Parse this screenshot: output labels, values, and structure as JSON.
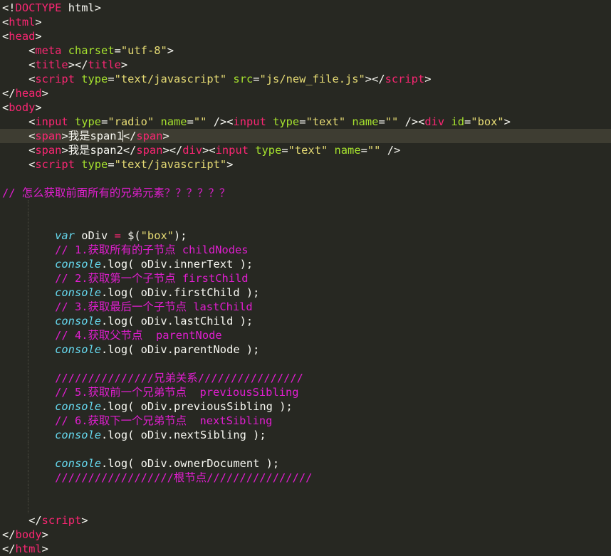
{
  "editor": {
    "theme": "monokai",
    "colors": {
      "background": "#272822",
      "current_line": "#3e3d32",
      "text": "#f8f8f2",
      "tag": "#f92672",
      "attribute": "#a6e22e",
      "string": "#e6db74",
      "keyword": "#66d9ef",
      "comment": "#e01ecf"
    },
    "current_line_index": 9,
    "lines": [
      [
        [
          "punct",
          "<!"
        ],
        [
          "tag",
          "DOCTYPE"
        ],
        [
          "plain",
          " html>"
        ]
      ],
      [
        [
          "punct",
          "<"
        ],
        [
          "tag",
          "html"
        ],
        [
          "punct",
          ">"
        ]
      ],
      [
        [
          "punct",
          "<"
        ],
        [
          "tag",
          "head"
        ],
        [
          "punct",
          ">"
        ]
      ],
      [
        [
          "plain",
          "    "
        ],
        [
          "punct",
          "<"
        ],
        [
          "tag",
          "meta"
        ],
        [
          "plain",
          " "
        ],
        [
          "attr",
          "charset"
        ],
        [
          "punct",
          "="
        ],
        [
          "str",
          "\"utf-8\""
        ],
        [
          "punct",
          ">"
        ]
      ],
      [
        [
          "plain",
          "    "
        ],
        [
          "punct",
          "<"
        ],
        [
          "tag",
          "title"
        ],
        [
          "punct",
          "></"
        ],
        [
          "tag",
          "title"
        ],
        [
          "punct",
          ">"
        ]
      ],
      [
        [
          "plain",
          "    "
        ],
        [
          "punct",
          "<"
        ],
        [
          "tag",
          "script"
        ],
        [
          "plain",
          " "
        ],
        [
          "attr",
          "type"
        ],
        [
          "punct",
          "="
        ],
        [
          "str",
          "\"text/javascript\""
        ],
        [
          "plain",
          " "
        ],
        [
          "attr",
          "src"
        ],
        [
          "punct",
          "="
        ],
        [
          "str",
          "\"js/new_file.js\""
        ],
        [
          "punct",
          "></"
        ],
        [
          "tag",
          "script"
        ],
        [
          "punct",
          ">"
        ]
      ],
      [
        [
          "punct",
          "</"
        ],
        [
          "tag",
          "head"
        ],
        [
          "punct",
          ">"
        ]
      ],
      [
        [
          "punct",
          "<"
        ],
        [
          "tag",
          "body"
        ],
        [
          "punct",
          ">"
        ]
      ],
      [
        [
          "plain",
          "    "
        ],
        [
          "punct",
          "<"
        ],
        [
          "tag",
          "input"
        ],
        [
          "plain",
          " "
        ],
        [
          "attr",
          "type"
        ],
        [
          "punct",
          "="
        ],
        [
          "str",
          "\"radio\""
        ],
        [
          "plain",
          " "
        ],
        [
          "attr",
          "name"
        ],
        [
          "punct",
          "="
        ],
        [
          "str",
          "\"\""
        ],
        [
          "plain",
          " "
        ],
        [
          "punct",
          "/><"
        ],
        [
          "tag",
          "input"
        ],
        [
          "plain",
          " "
        ],
        [
          "attr",
          "type"
        ],
        [
          "punct",
          "="
        ],
        [
          "str",
          "\"text\""
        ],
        [
          "plain",
          " "
        ],
        [
          "attr",
          "name"
        ],
        [
          "punct",
          "="
        ],
        [
          "str",
          "\"\""
        ],
        [
          "plain",
          " "
        ],
        [
          "punct",
          "/><"
        ],
        [
          "tag",
          "div"
        ],
        [
          "plain",
          " "
        ],
        [
          "attr",
          "id"
        ],
        [
          "punct",
          "="
        ],
        [
          "str",
          "\"box\""
        ],
        [
          "punct",
          ">"
        ]
      ],
      [
        [
          "plain",
          "    "
        ],
        [
          "punct",
          "<"
        ],
        [
          "tag",
          "span"
        ],
        [
          "punct",
          ">"
        ],
        [
          "plain",
          "我是span1"
        ],
        [
          "cursor",
          ""
        ],
        [
          "punct",
          "</"
        ],
        [
          "tag",
          "span"
        ],
        [
          "punct",
          ">"
        ]
      ],
      [
        [
          "plain",
          "    "
        ],
        [
          "punct",
          "<"
        ],
        [
          "tag",
          "span"
        ],
        [
          "punct",
          ">"
        ],
        [
          "plain",
          "我是span2"
        ],
        [
          "punct",
          "</"
        ],
        [
          "tag",
          "span"
        ],
        [
          "punct",
          "></"
        ],
        [
          "tag",
          "div"
        ],
        [
          "punct",
          "><"
        ],
        [
          "tag",
          "input"
        ],
        [
          "plain",
          " "
        ],
        [
          "attr",
          "type"
        ],
        [
          "punct",
          "="
        ],
        [
          "str",
          "\"text\""
        ],
        [
          "plain",
          " "
        ],
        [
          "attr",
          "name"
        ],
        [
          "punct",
          "="
        ],
        [
          "str",
          "\"\""
        ],
        [
          "plain",
          " "
        ],
        [
          "punct",
          "/>"
        ]
      ],
      [
        [
          "plain",
          "    "
        ],
        [
          "punct",
          "<"
        ],
        [
          "tag",
          "script"
        ],
        [
          "plain",
          " "
        ],
        [
          "attr",
          "type"
        ],
        [
          "punct",
          "="
        ],
        [
          "str",
          "\"text/javascript\""
        ],
        [
          "punct",
          ">"
        ]
      ],
      [],
      [
        [
          "comment",
          "// 怎么获取前面所有的兄弟元素？？？？？？"
        ]
      ],
      [],
      [],
      [
        [
          "plain",
          "        "
        ],
        [
          "kw",
          "var"
        ],
        [
          "plain",
          " oDiv "
        ],
        [
          "kwop",
          "="
        ],
        [
          "plain",
          " $("
        ],
        [
          "str",
          "\"box\""
        ],
        [
          "plain",
          ");"
        ]
      ],
      [
        [
          "plain",
          "        "
        ],
        [
          "comment",
          "// 1.获取所有的子节点 childNodes"
        ]
      ],
      [
        [
          "plain",
          "        "
        ],
        [
          "obj",
          "console"
        ],
        [
          "plain",
          ".log( oDiv.innerText );"
        ]
      ],
      [
        [
          "plain",
          "        "
        ],
        [
          "comment",
          "// 2.获取第一个子节点 firstChild"
        ]
      ],
      [
        [
          "plain",
          "        "
        ],
        [
          "obj",
          "console"
        ],
        [
          "plain",
          ".log( oDiv.firstChild );"
        ]
      ],
      [
        [
          "plain",
          "        "
        ],
        [
          "comment",
          "// 3.获取最后一个子节点 lastChild"
        ]
      ],
      [
        [
          "plain",
          "        "
        ],
        [
          "obj",
          "console"
        ],
        [
          "plain",
          ".log( oDiv.lastChild );"
        ]
      ],
      [
        [
          "plain",
          "        "
        ],
        [
          "comment",
          "// 4.获取父节点  parentNode"
        ]
      ],
      [
        [
          "plain",
          "        "
        ],
        [
          "obj",
          "console"
        ],
        [
          "plain",
          ".log( oDiv.parentNode );"
        ]
      ],
      [],
      [
        [
          "plain",
          "        "
        ],
        [
          "comment",
          "///////////////兄弟关系////////////////"
        ]
      ],
      [
        [
          "plain",
          "        "
        ],
        [
          "comment",
          "// 5.获取前一个兄弟节点  previousSibling"
        ]
      ],
      [
        [
          "plain",
          "        "
        ],
        [
          "obj",
          "console"
        ],
        [
          "plain",
          ".log( oDiv.previousSibling );"
        ]
      ],
      [
        [
          "plain",
          "        "
        ],
        [
          "comment",
          "// 6.获取下一个兄弟节点  nextSibling"
        ]
      ],
      [
        [
          "plain",
          "        "
        ],
        [
          "obj",
          "console"
        ],
        [
          "plain",
          ".log( oDiv.nextSibling );"
        ]
      ],
      [],
      [
        [
          "plain",
          "        "
        ],
        [
          "obj",
          "console"
        ],
        [
          "plain",
          ".log( oDiv.ownerDocument );"
        ]
      ],
      [
        [
          "plain",
          "        "
        ],
        [
          "comment",
          "//////////////////根节点////////////////"
        ]
      ],
      [],
      [],
      [
        [
          "plain",
          "    "
        ],
        [
          "punct",
          "</"
        ],
        [
          "tag",
          "script"
        ],
        [
          "punct",
          ">"
        ]
      ],
      [
        [
          "punct",
          "</"
        ],
        [
          "tag",
          "body"
        ],
        [
          "punct",
          ">"
        ]
      ],
      [
        [
          "punct",
          "</"
        ],
        [
          "tag",
          "html"
        ],
        [
          "punct",
          ">"
        ]
      ]
    ]
  }
}
